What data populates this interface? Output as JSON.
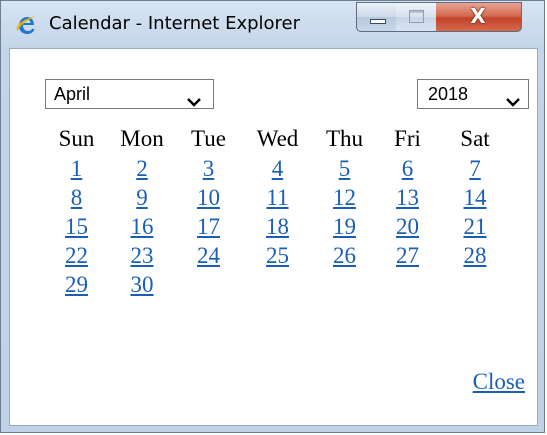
{
  "window": {
    "title": "Calendar - Internet Explorer",
    "app_icon": "internet-explorer-icon",
    "buttons": {
      "minimize_icon": "minimize-icon",
      "maximize_icon": "maximize-icon",
      "close_glyph": "X"
    }
  },
  "calendar": {
    "month": {
      "selected": "April",
      "icon": "chevron-down-icon"
    },
    "year": {
      "selected": "2018",
      "icon": "chevron-down-icon"
    },
    "weekdays": [
      "Sun",
      "Mon",
      "Tue",
      "Wed",
      "Thu",
      "Fri",
      "Sat"
    ],
    "weeks": [
      [
        "1",
        "2",
        "3",
        "4",
        "5",
        "6",
        "7"
      ],
      [
        "8",
        "9",
        "10",
        "11",
        "12",
        "13",
        "14"
      ],
      [
        "15",
        "16",
        "17",
        "18",
        "19",
        "20",
        "21"
      ],
      [
        "22",
        "23",
        "24",
        "25",
        "26",
        "27",
        "28"
      ],
      [
        "29",
        "30",
        "",
        "",
        "",
        "",
        ""
      ]
    ],
    "close_label": "Close"
  },
  "colors": {
    "link": "#1a5fb4",
    "close_button": "#c3432a",
    "frame": "#c4d5e9"
  }
}
